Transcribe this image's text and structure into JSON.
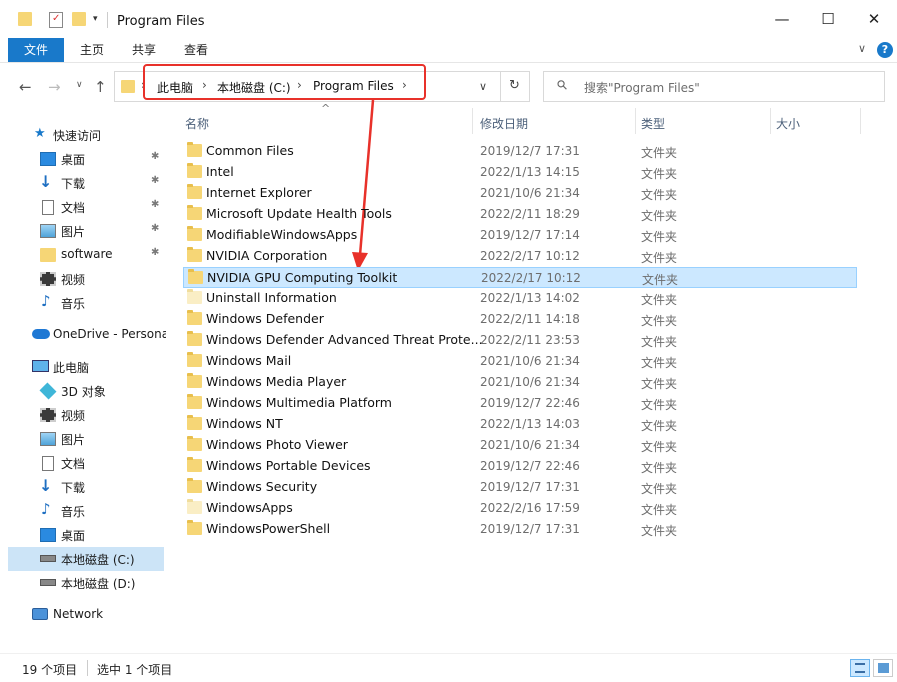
{
  "window": {
    "title": "Program Files",
    "minimize_glyph": "—",
    "maximize_glyph": "☐",
    "close_glyph": "✕"
  },
  "ribbon": {
    "tabs": [
      "文件",
      "主页",
      "共享",
      "查看"
    ],
    "collapse_glyph": "∨",
    "help_glyph": "?"
  },
  "nav": {
    "back_glyph": "←",
    "forward_glyph": "→",
    "history_glyph": "∨",
    "up_glyph": "↑",
    "refresh_glyph": "↻",
    "dropdown_glyph": "∨",
    "breadcrumbs": [
      "此电脑",
      "本地磁盘 (C:)",
      "Program Files"
    ],
    "breadcrumb_sep": "›",
    "search_placeholder": "搜索\"Program Files\"",
    "search_glyph": "⚲"
  },
  "sidebar": {
    "items": [
      {
        "label": "快速访问",
        "icon": "star-icon"
      },
      {
        "label": "桌面",
        "icon": "desktop-icon",
        "pinned": true
      },
      {
        "label": "下载",
        "icon": "download-icon",
        "pinned": true
      },
      {
        "label": "文档",
        "icon": "document-icon",
        "pinned": true
      },
      {
        "label": "图片",
        "icon": "pictures-icon",
        "pinned": true
      },
      {
        "label": "software",
        "icon": "folder-icon",
        "pinned": true
      },
      {
        "label": "视频",
        "icon": "videos-icon"
      },
      {
        "label": "音乐",
        "icon": "music-icon"
      },
      {
        "label": "OneDrive - Persona",
        "icon": "onedrive-icon"
      },
      {
        "label": "此电脑",
        "icon": "computer-icon"
      },
      {
        "label": "3D 对象",
        "icon": "3d-objects-icon"
      },
      {
        "label": "视频",
        "icon": "videos-icon"
      },
      {
        "label": "图片",
        "icon": "pictures-icon"
      },
      {
        "label": "文档",
        "icon": "document-icon"
      },
      {
        "label": "下载",
        "icon": "download-icon"
      },
      {
        "label": "音乐",
        "icon": "music-icon"
      },
      {
        "label": "桌面",
        "icon": "desktop-icon"
      },
      {
        "label": "本地磁盘 (C:)",
        "icon": "drive-c-icon",
        "selected": true
      },
      {
        "label": "本地磁盘 (D:)",
        "icon": "drive-d-icon"
      },
      {
        "label": "Network",
        "icon": "network-icon"
      }
    ],
    "pin_glyph": "📌"
  },
  "columns": {
    "name": "名称",
    "modified": "修改日期",
    "type": "类型",
    "size": "大小",
    "sort_glyph": "^"
  },
  "files": [
    {
      "name": "Common Files",
      "modified": "2019/12/7 17:31",
      "type": "文件夹"
    },
    {
      "name": "Intel",
      "modified": "2022/1/13 14:15",
      "type": "文件夹"
    },
    {
      "name": "Internet Explorer",
      "modified": "2021/10/6 21:34",
      "type": "文件夹"
    },
    {
      "name": "Microsoft Update Health Tools",
      "modified": "2022/2/11 18:29",
      "type": "文件夹"
    },
    {
      "name": "ModifiableWindowsApps",
      "modified": "2019/12/7 17:14",
      "type": "文件夹"
    },
    {
      "name": "NVIDIA Corporation",
      "modified": "2022/2/17 10:12",
      "type": "文件夹"
    },
    {
      "name": "NVIDIA GPU Computing Toolkit",
      "modified": "2022/2/17 10:12",
      "type": "文件夹",
      "selected": true
    },
    {
      "name": "Uninstall Information",
      "modified": "2022/1/13 14:02",
      "type": "文件夹",
      "hidden": true
    },
    {
      "name": "Windows Defender",
      "modified": "2022/2/11 14:18",
      "type": "文件夹"
    },
    {
      "name": "Windows Defender Advanced Threat Prote...",
      "modified": "2022/2/11 23:53",
      "type": "文件夹"
    },
    {
      "name": "Windows Mail",
      "modified": "2021/10/6 21:34",
      "type": "文件夹"
    },
    {
      "name": "Windows Media Player",
      "modified": "2021/10/6 21:34",
      "type": "文件夹"
    },
    {
      "name": "Windows Multimedia Platform",
      "modified": "2019/12/7 22:46",
      "type": "文件夹"
    },
    {
      "name": "Windows NT",
      "modified": "2022/1/13 14:03",
      "type": "文件夹"
    },
    {
      "name": "Windows Photo Viewer",
      "modified": "2021/10/6 21:34",
      "type": "文件夹"
    },
    {
      "name": "Windows Portable Devices",
      "modified": "2019/12/7 22:46",
      "type": "文件夹"
    },
    {
      "name": "Windows Security",
      "modified": "2019/12/7 17:31",
      "type": "文件夹"
    },
    {
      "name": "WindowsApps",
      "modified": "2022/2/16 17:59",
      "type": "文件夹",
      "hidden": true
    },
    {
      "name": "WindowsPowerShell",
      "modified": "2019/12/7 17:31",
      "type": "文件夹"
    }
  ],
  "status": {
    "item_count": "19 个项目",
    "selected_count": "选中 1 个项目"
  },
  "colors": {
    "accent": "#1979ca",
    "selection": "#cce8ff",
    "annotation": "#e8312a",
    "folder": "#f6d676"
  }
}
